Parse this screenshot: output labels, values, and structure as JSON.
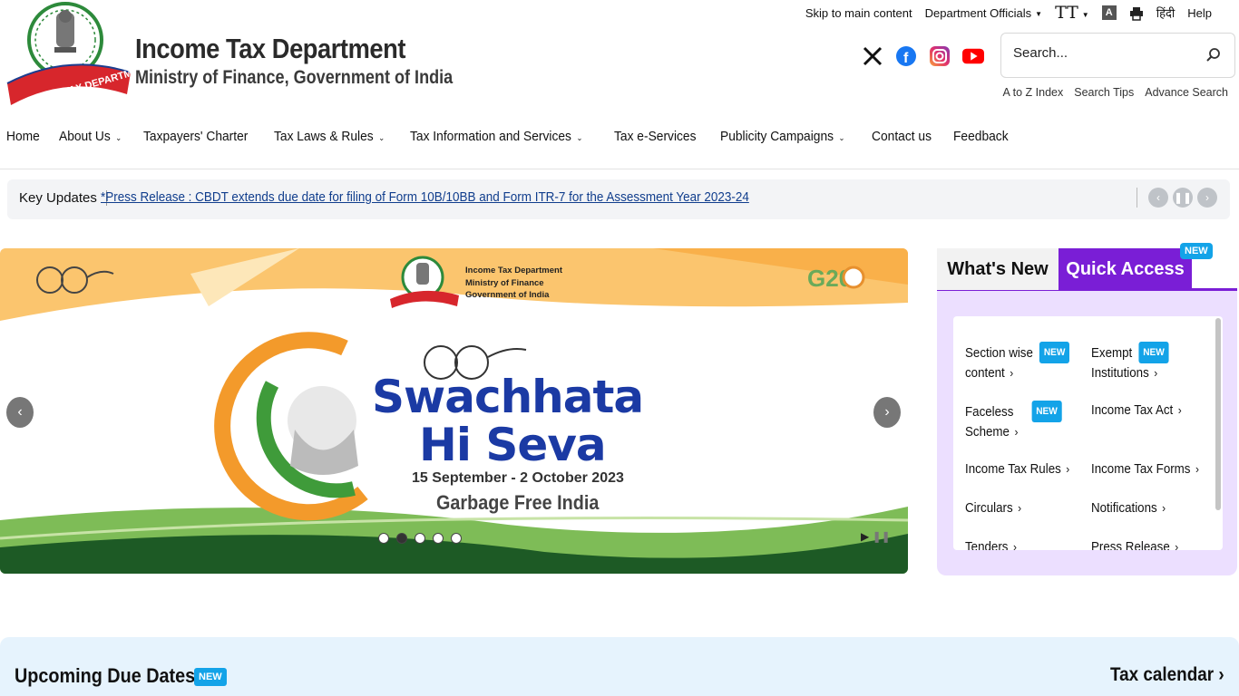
{
  "header": {
    "title": "Income Tax Department",
    "subtitle": "Ministry of Finance, Government of India",
    "logo_text": "INCOME TAX DEPARTMENT"
  },
  "topbar": {
    "skip": "Skip to main content",
    "dept": "Department Officials",
    "text_size_icon": "TT",
    "contrast_icon": "A",
    "hindi": "हिंदी",
    "help": "Help"
  },
  "social": [
    "x-icon",
    "facebook-icon",
    "instagram-icon",
    "youtube-icon"
  ],
  "search": {
    "placeholder": "Search...",
    "links": [
      "A to Z Index",
      "Search Tips",
      "Advance Search"
    ]
  },
  "nav": {
    "items": [
      {
        "label": "Home"
      },
      {
        "label": "About Us"
      },
      {
        "label": "Taxpayers' Charter"
      },
      {
        "label": "Tax Laws & Rules"
      },
      {
        "label": "Tax Information and Services"
      },
      {
        "label": "Tax e-Services"
      },
      {
        "label": "Publicity Campaigns"
      },
      {
        "label": "Contact us"
      },
      {
        "label": "Feedback"
      }
    ]
  },
  "key_updates": {
    "label": "Key Updates",
    "text": "*Press Release : CBDT extends due date for filing of Form 10B/10BB and Form ITR-7 for the Assessment Year 2023-24"
  },
  "banner": {
    "org_line1": "Income Tax Department",
    "org_line2": "Ministry of Finance",
    "org_line3": "Government of India",
    "headline1": "Swachhata",
    "headline2": "Hi Seva",
    "dates": "15 September - 2 October 2023",
    "tagline": "Garbage Free India",
    "g20": "G20"
  },
  "panel": {
    "tab_whats_new": "What's New",
    "tab_quick_access": "Quick Access",
    "tab_badge": "NEW",
    "items": [
      {
        "label1": "Section wise",
        "label2": "content",
        "badge": "NEW"
      },
      {
        "label1": "Exempt",
        "label2": "Institutions",
        "badge": "NEW"
      },
      {
        "label1": "Faceless",
        "label2": "Scheme",
        "badge": "NEW"
      },
      {
        "label1": "Income Tax Act"
      },
      {
        "label1": "Income Tax Rules"
      },
      {
        "label1": "Income Tax Forms"
      },
      {
        "label1": "Circulars"
      },
      {
        "label1": "Notifications"
      },
      {
        "label1": "Tenders"
      },
      {
        "label1": "Press Release"
      }
    ]
  },
  "due_dates": {
    "title": "Upcoming Due Dates",
    "badge": "NEW",
    "calendar": "Tax calendar"
  },
  "colors": {
    "accent_purple": "#7a1ed6",
    "badge_blue": "#13a3e8",
    "headline_blue": "#1b3aa4",
    "logo_red": "#d7262c"
  }
}
